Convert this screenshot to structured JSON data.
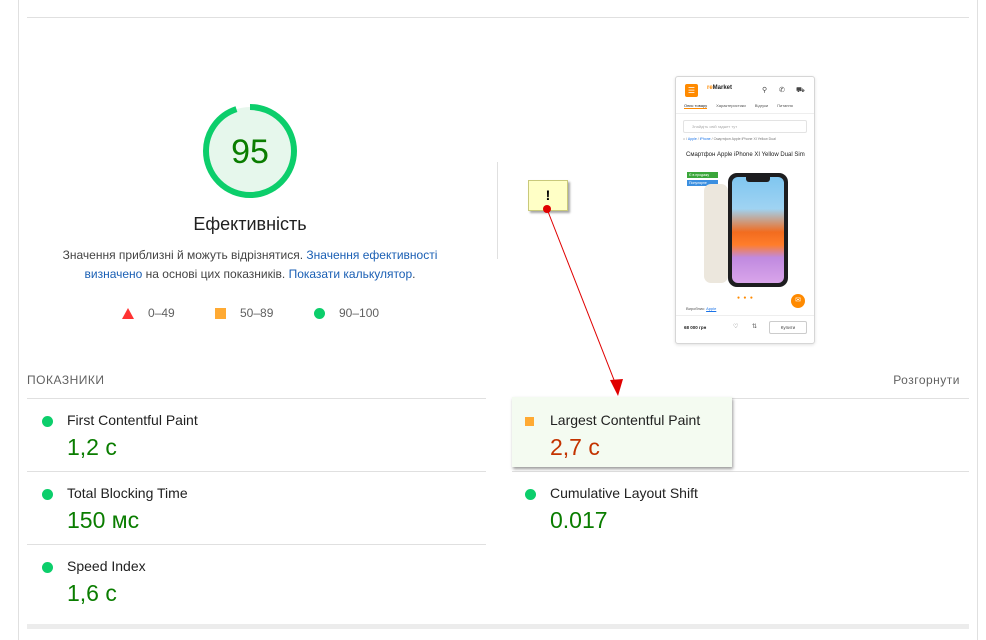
{
  "score": {
    "value": "95",
    "title": "Ефективність"
  },
  "description": {
    "text_before": "Значення приблизні й можуть відрізнятися. ",
    "link1": "Значення ефективності визначено",
    "text_middle": " на основі цих показників. ",
    "link2": "Показати калькулятор",
    "text_after": "."
  },
  "legend": {
    "fail": "0–49",
    "average": "50–89",
    "pass": "90–100"
  },
  "screenshot_thumb": {
    "logo_prefix": "re",
    "logo_suffix": "Market",
    "tabs": [
      "Опис товару",
      "Характеристики",
      "Відгуки",
      "Питання"
    ],
    "search_placeholder": "Знайдіть свій гаджет тут",
    "breadcrumb_root": "⌂",
    "breadcrumb_1": "Apple",
    "breadcrumb_2": "iPhone",
    "breadcrumb_3": "Смартфон Apple iPhone XI Yellow Dual",
    "product_title": "Смартфон Apple iPhone XI Yellow Dual Sim",
    "badge_1": "Є в продажу",
    "badge_2": "Популярне",
    "maker_label": "Виробник:",
    "maker_value": "Apple",
    "price": "68 000 грн",
    "buy_label": "Купити"
  },
  "tooltip": {
    "text": "!"
  },
  "metrics_header": {
    "label": "ПОКАЗНИКИ",
    "expand": "Розгорнути"
  },
  "metrics": {
    "fcp": {
      "name": "First Contentful Paint",
      "value": "1,2 с",
      "rating": "pass"
    },
    "lcp": {
      "name": "Largest Contentful Paint",
      "value": "2,7 с",
      "rating": "average"
    },
    "tbt": {
      "name": "Total Blocking Time",
      "value": "150 мс",
      "rating": "pass"
    },
    "cls": {
      "name": "Cumulative Layout Shift",
      "value": "0.017",
      "rating": "pass"
    },
    "si": {
      "name": "Speed Index",
      "value": "1,6 с",
      "rating": "pass"
    }
  },
  "colors": {
    "pass": "#0cce6b",
    "pass_text": "#0a7d00",
    "average": "#ffaa33",
    "average_text": "#c33300",
    "fail": "#ff3333",
    "link": "#1a5fb4"
  }
}
